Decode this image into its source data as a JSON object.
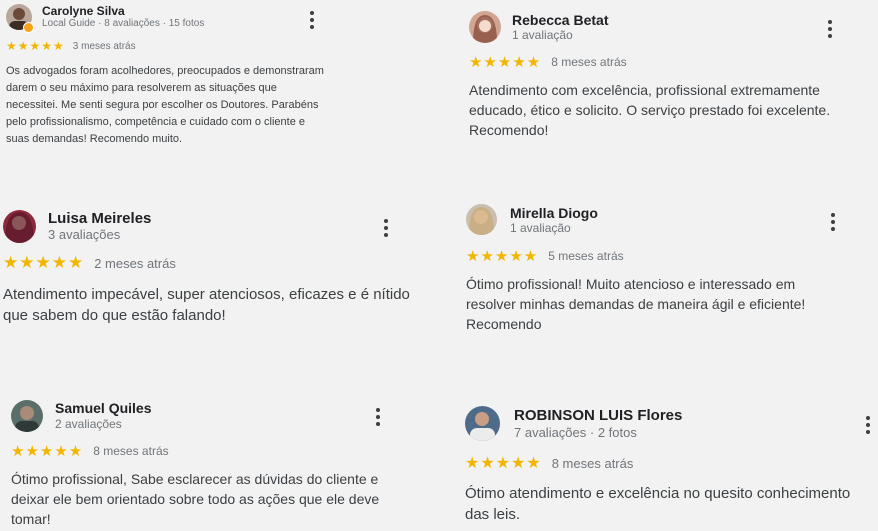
{
  "reviews": [
    {
      "name": "Carolyne Silva",
      "meta": "Local Guide · 8 avaliações · 15 fotos",
      "stars": "★★★★★",
      "date": "3 meses atrás",
      "text": "Os advogados foram acolhedores, preocupados e demonstraram darem o seu máximo para resolverem as situações que necessitei. Me senti segura por escolher os Doutores. Parabéns pelo profissionalismo, competência e cuidado com o cliente e suas demandas! Recomendo muito.",
      "rating": 5
    },
    {
      "name": "Rebecca Betat",
      "meta": "1 avaliação",
      "stars": "★★★★★",
      "date": "8 meses atrás",
      "text": "Atendimento com excelência, profissional extremamente educado, ético e solicito. O serviço prestado foi excelente. Recomendo!",
      "rating": 5
    },
    {
      "name": "Luisa Meireles",
      "meta": "3 avaliações",
      "stars": "★★★★★",
      "date": "2 meses atrás",
      "text": "Atendimento impecável, super atenciosos, eficazes e é nítido que sabem do que estão falando!",
      "rating": 5
    },
    {
      "name": "Mirella Diogo",
      "meta": "1 avaliação",
      "stars": "★★★★★",
      "date": "5 meses atrás",
      "text": "Ótimo profissional! Muito atencioso e interessado em resolver minhas demandas de maneira ágil e eficiente! Recomendo",
      "rating": 5
    },
    {
      "name": "Samuel Quiles",
      "meta": "2 avaliações",
      "stars": "★★★★★",
      "date": "8 meses atrás",
      "text": "Ótimo profissional, Sabe esclarecer as dúvidas do cliente e deixar ele bem orientado sobre todo as ações que ele deve tomar!",
      "rating": 5
    },
    {
      "name": "ROBINSON LUIS Flores",
      "meta": "7 avaliações · 2 fotos",
      "stars": "★★★★★",
      "date": "8 meses atrás",
      "text": "Ótimo atendimento e excelência no quesito conhecimento das leis.",
      "rating": 5
    }
  ],
  "colors": {
    "star": "#f2b600",
    "badge": "#f7a21b",
    "meta": "#70757a"
  }
}
